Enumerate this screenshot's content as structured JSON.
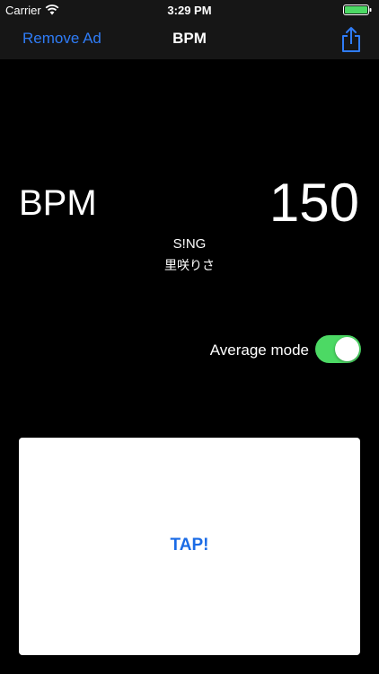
{
  "status_bar": {
    "carrier": "Carrier",
    "time": "3:29 PM",
    "icons": [
      "wifi-icon",
      "battery-icon"
    ]
  },
  "nav": {
    "left_label": "Remove Ad",
    "title": "BPM",
    "right_icon": "share-icon"
  },
  "main": {
    "bpm_label": "BPM",
    "bpm_value": "150",
    "song_title": "S!NG",
    "song_artist": "里咲りさ"
  },
  "average_mode": {
    "label": "Average mode",
    "enabled": true
  },
  "tap_button": {
    "label": "TAP!"
  },
  "colors": {
    "background": "#000000",
    "bar_background": "#161616",
    "accent": "#2f7cf6",
    "toggle_on": "#4cd964",
    "battery": "#4cd964",
    "tap_text": "#1a6be6"
  }
}
